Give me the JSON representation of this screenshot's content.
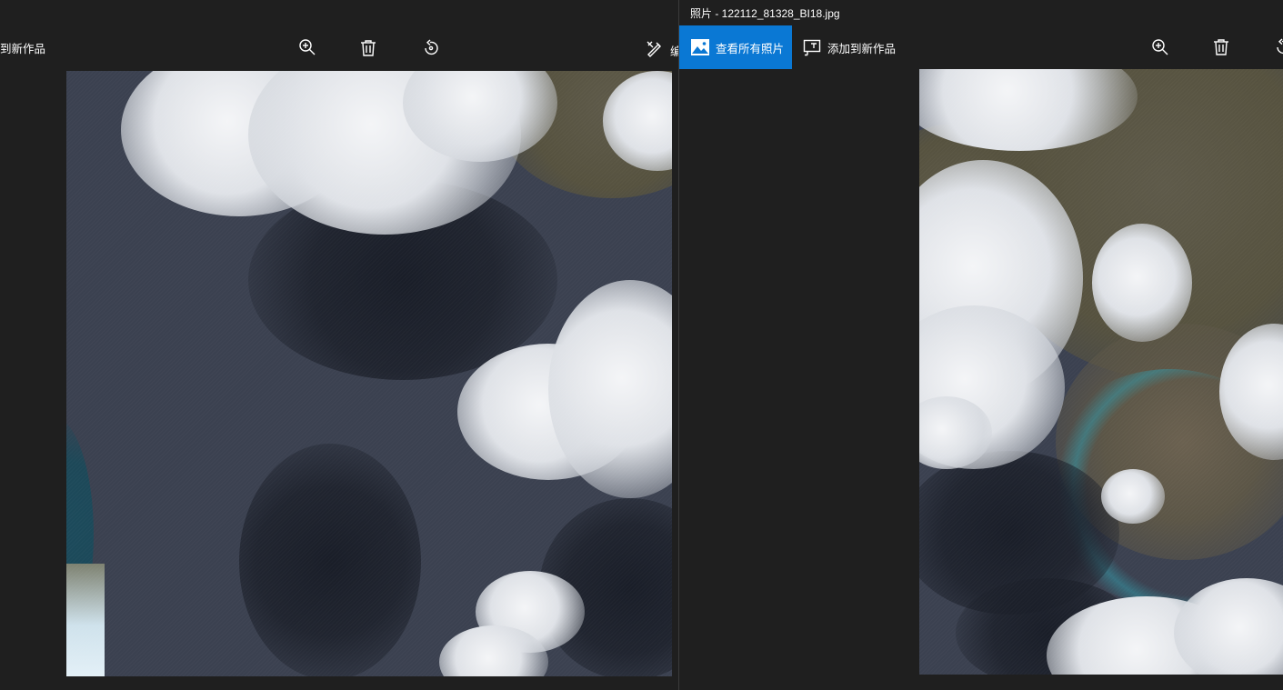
{
  "left_window": {
    "toolbar": {
      "add_to_creation_partial": "到新作品",
      "edit_partial": "编"
    },
    "icons": [
      "zoom-in-icon",
      "delete-icon",
      "rotate-icon",
      "edit-icon"
    ]
  },
  "right_window": {
    "title": "照片 - 122112_81328_BI18.jpg",
    "toolbar": {
      "view_all_photos": "查看所有照片",
      "add_to_new_creation": "添加到新作品"
    },
    "icons": [
      "photos-icon",
      "add-to-creation-icon",
      "zoom-in-icon",
      "delete-icon",
      "rotate-icon"
    ]
  },
  "colors": {
    "background": "#1f1f1f",
    "accent": "#0a78d4",
    "water": "#3b4150",
    "cloud": "#e6e8ec"
  }
}
